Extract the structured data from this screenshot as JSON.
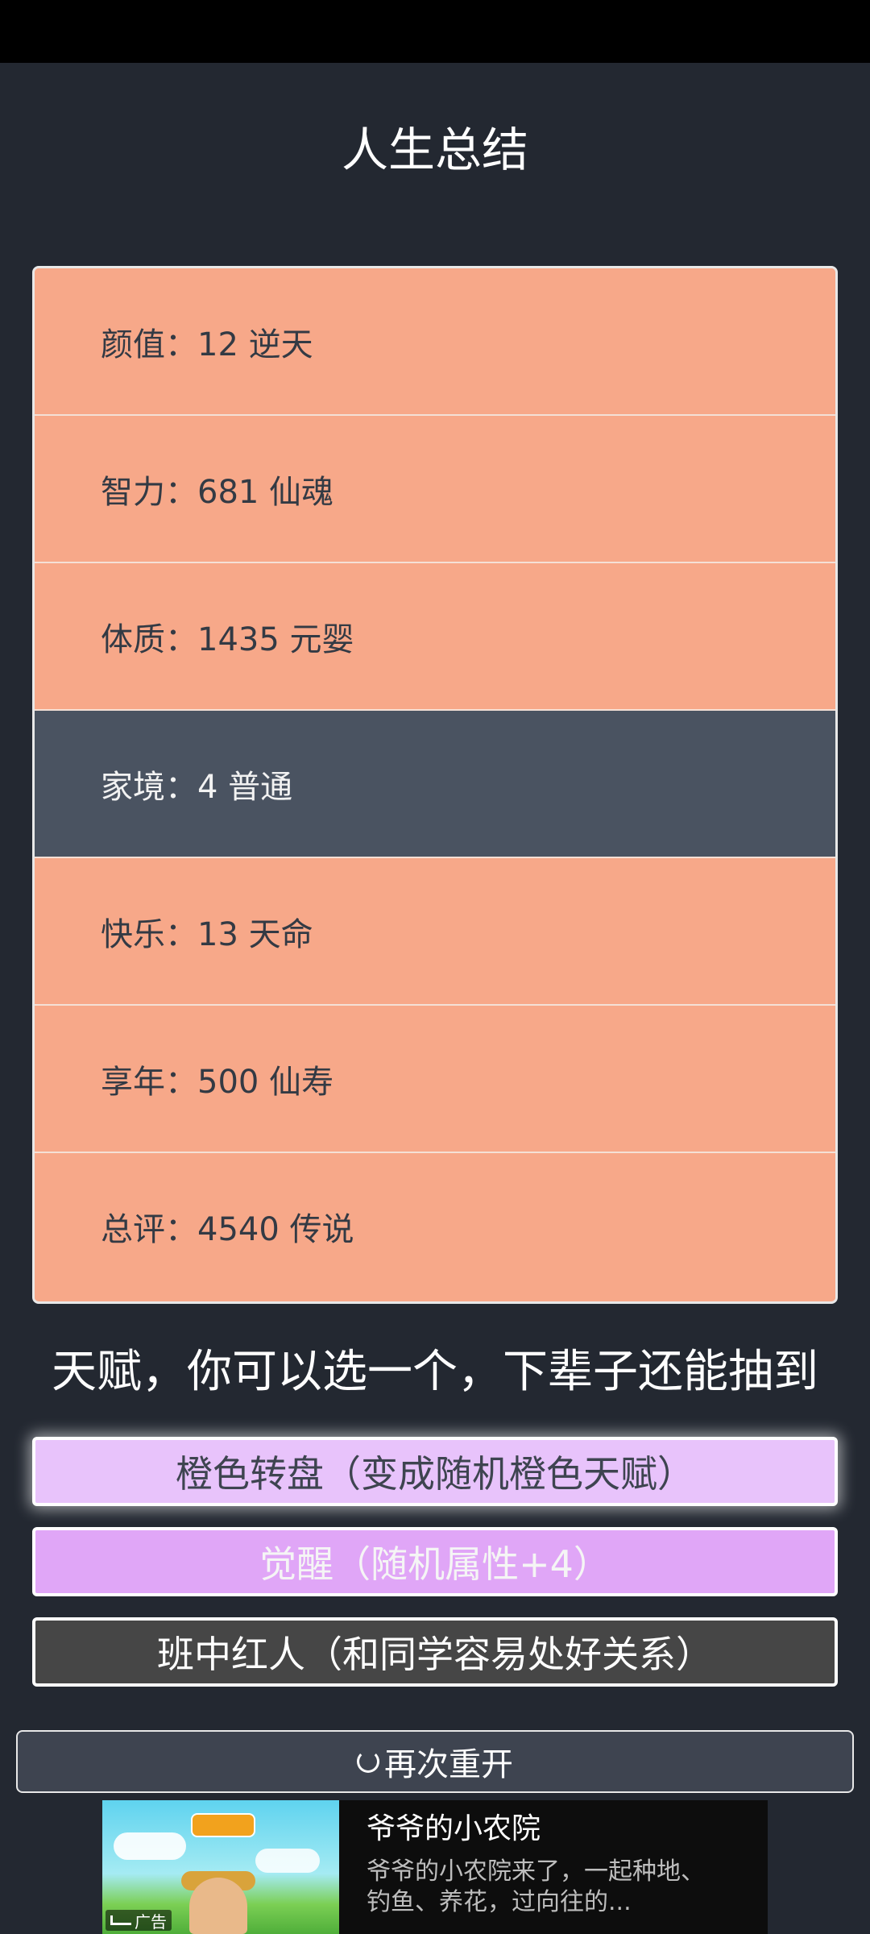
{
  "page": {
    "title": "人生总结"
  },
  "stats": [
    {
      "label": "颜值：12 逆天"
    },
    {
      "label": "智力：681 仙魂"
    },
    {
      "label": "体质：1435 元婴"
    },
    {
      "label": "家境：4 普通"
    },
    {
      "label": "快乐：13 天命"
    },
    {
      "label": "享年：500 仙寿"
    },
    {
      "label": "总评：4540 传说"
    }
  ],
  "talents": {
    "heading": "天赋，你可以选一个，下辈子还能抽到",
    "options": [
      {
        "label": "橙色转盘（变成随机橙色天赋）"
      },
      {
        "label": "觉醒（随机属性+4）"
      },
      {
        "label": "班中红人（和同学容易处好关系）"
      }
    ]
  },
  "restart": {
    "label": "再次重开",
    "icon": "refresh-icon"
  },
  "ad": {
    "tag": "广告",
    "title": "爷爷的小农院",
    "description": "爷爷的小农院来了，一起种地、钓鱼、养花，过向往的..."
  },
  "colors": {
    "background": "#232831",
    "stat_orange": "#f7a889",
    "stat_dark": "#4a5361",
    "talent_light_purple": "#e8c3fb",
    "talent_purple": "#e0a6f7",
    "talent_gray": "#464646"
  }
}
